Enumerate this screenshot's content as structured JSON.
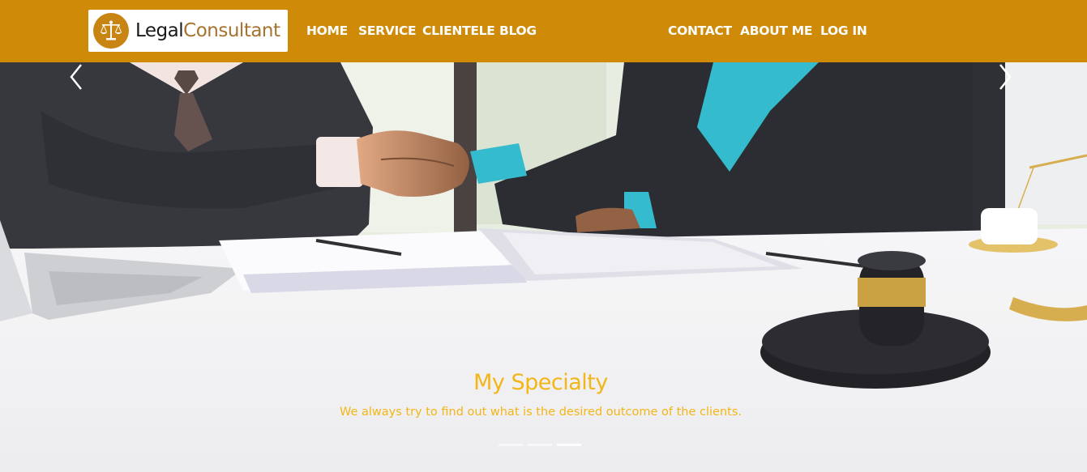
{
  "brand": {
    "word1": "Legal",
    "word2": "Consultant",
    "icon": "scales-of-justice-icon"
  },
  "nav": {
    "left": [
      "HOME",
      "SERVICE",
      "CLIENTELE",
      "BLOG"
    ],
    "right": [
      "CONTACT",
      "ABOUT ME",
      "LOG IN"
    ]
  },
  "carousel": {
    "title": "My Specialty",
    "text": "We always try to find out what is the desired outcome of the clients.",
    "slide_count": 3,
    "active_slide": 3,
    "prev_icon": "chevron-left-icon",
    "next_icon": "chevron-right-icon"
  },
  "colors": {
    "nav_bg": "#cf8a07",
    "caption": "#f2b618",
    "brand_accent": "#a6732f"
  }
}
